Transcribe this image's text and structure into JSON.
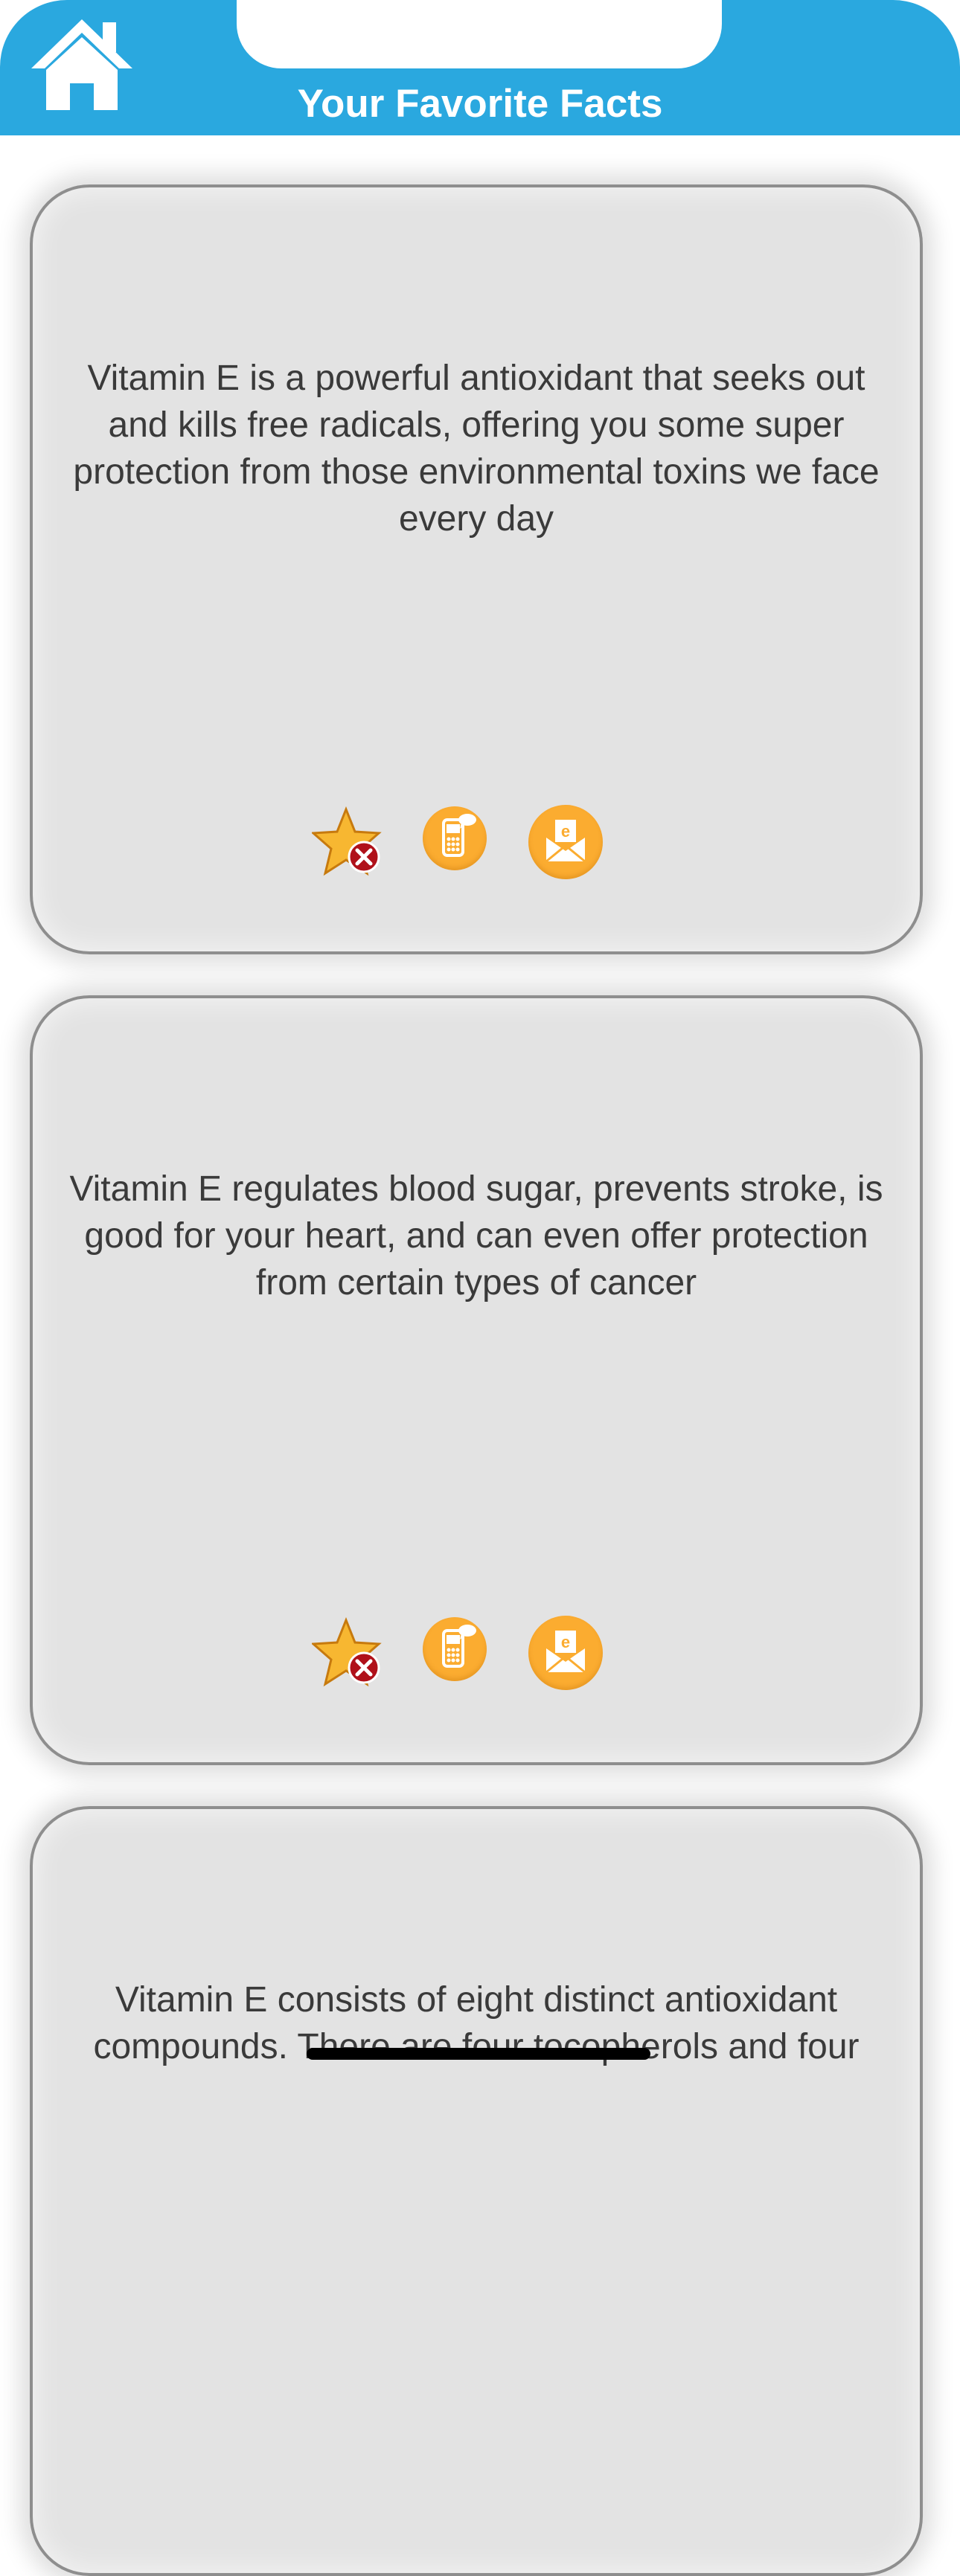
{
  "header": {
    "title": "Your Favorite Facts",
    "home_icon": "home-icon"
  },
  "colors": {
    "header_bg": "#2aa8df",
    "card_bg": "#e3e3e3",
    "action_orange": "#fbac30",
    "remove_red": "#b0111a"
  },
  "facts": [
    {
      "text": "Vitamin E is a powerful antioxidant that seeks out and kills free radicals, offering you some super protection from those environmental toxins we face every day",
      "actions": [
        "star-remove-icon",
        "sms-phone-icon",
        "email-icon"
      ]
    },
    {
      "text": "Vitamin E regulates blood sugar, prevents stroke, is good for your heart, and can even offer protection from certain types of cancer",
      "actions": [
        "star-remove-icon",
        "sms-phone-icon",
        "email-icon"
      ]
    },
    {
      "text": "Vitamin E consists of eight distinct antioxidant compounds. There are four tocopherols and four",
      "actions": []
    }
  ]
}
